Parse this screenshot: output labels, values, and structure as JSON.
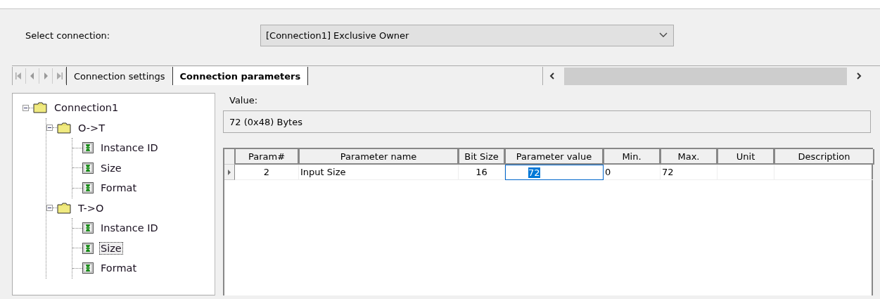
{
  "connection_select": {
    "label": "Select connection:",
    "value": "[Connection1] Exclusive Owner"
  },
  "tabs": [
    {
      "label": "Connection settings",
      "selected": false
    },
    {
      "label": "Connection parameters",
      "selected": true
    }
  ],
  "tree": [
    {
      "label": "Connection1",
      "kind": "folder",
      "expanded": true,
      "selected": false,
      "children": [
        {
          "label": "O->T",
          "kind": "folder",
          "expanded": true,
          "selected": false,
          "children": [
            {
              "label": "Instance ID",
              "kind": "param",
              "selected": false
            },
            {
              "label": "Size",
              "kind": "param",
              "selected": false
            },
            {
              "label": "Format",
              "kind": "param",
              "selected": false
            }
          ]
        },
        {
          "label": "T->O",
          "kind": "folder",
          "expanded": true,
          "selected": false,
          "children": [
            {
              "label": "Instance ID",
              "kind": "param",
              "selected": false
            },
            {
              "label": "Size",
              "kind": "param",
              "selected": true
            },
            {
              "label": "Format",
              "kind": "param",
              "selected": false
            }
          ]
        }
      ]
    }
  ],
  "value": {
    "label": "Value:",
    "text": "72 (0x48) Bytes"
  },
  "table": {
    "columns": [
      "Param#",
      "Parameter name",
      "Bit Size",
      "Parameter value",
      "Min.",
      "Max.",
      "Unit",
      "Description"
    ],
    "rows": [
      {
        "current": true,
        "cells": [
          "2",
          "Input Size",
          "16",
          "72",
          "0",
          "72",
          "",
          ""
        ],
        "editing": [
          false,
          false,
          false,
          true,
          false,
          false,
          false,
          false
        ]
      }
    ]
  }
}
